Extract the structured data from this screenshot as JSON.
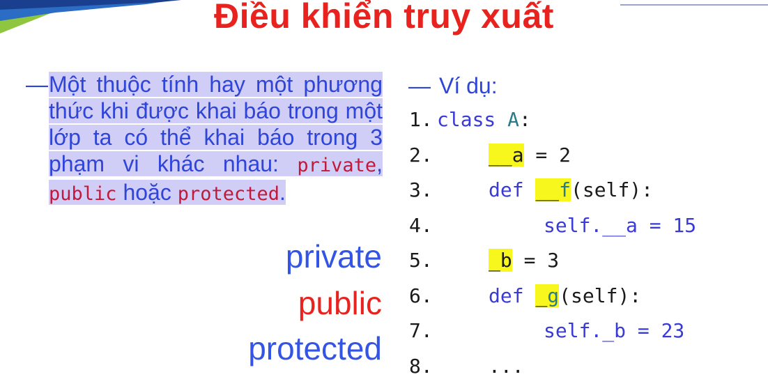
{
  "slide": {
    "title": "Điều khiển truy xuất",
    "bullet": {
      "text_before": "Một thuộc tính hay một phương thức khi được khai báo trong một lớp ta có thể khai báo trong 3 phạm vi khác nhau: ",
      "kw_private": "private",
      "sep1": ", ",
      "kw_public": "public",
      "sep2": " hoặc ",
      "kw_protected": "protected",
      "end": "."
    },
    "legend": {
      "private": "private",
      "public": "public",
      "protected": "protected"
    },
    "example_label": "Ví dụ:",
    "code": {
      "l1_num": "1.",
      "l1_kw": "class",
      "l1_name": "A",
      "l1_tail": ":",
      "l2_num": "2.",
      "l2_hl": "__a",
      "l2_tail": " = 2",
      "l3_num": "3.",
      "l3_kw": "def",
      "l3_hl1": "__",
      "l3_hl2": "f",
      "l3_tail": "(self):",
      "l4_num": "4.",
      "l4_text": "self.__a = 15",
      "l5_num": "5.",
      "l5_hl": "_b",
      "l5_tail": " = 3",
      "l6_num": "6.",
      "l6_kw": "def",
      "l6_hl1": "_",
      "l6_hl2": "g",
      "l6_tail": "(self):",
      "l7_num": "7.",
      "l7_text": "self._b = 23",
      "l8_num": "8.",
      "l8_text": "..."
    },
    "colors": {
      "title": "#e8231f",
      "text": "#2f45d8",
      "keyword_red": "#c0193a",
      "highlight_purple": "#d0cdf6",
      "highlight_yellow": "#f7f71d"
    }
  }
}
